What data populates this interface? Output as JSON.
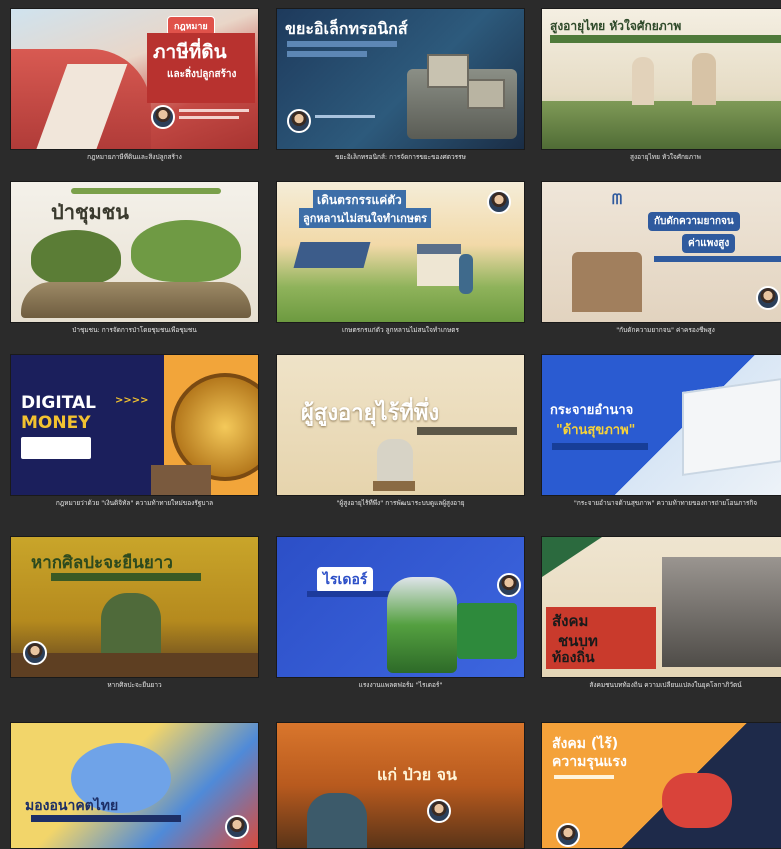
{
  "cards": [
    {
      "title": "ภาษีที่ดิน",
      "subtitle": "และสิ่งปลูกสร้าง",
      "badge": "กฎหมาย",
      "caption": "กฎหมายภาษีที่ดินและสิ่งปลูกสร้าง"
    },
    {
      "title": "ขยะอิเล็กทรอนิกส์",
      "caption": "ขยะอิเล็กทรอนิกส์: การจัดการขยะของศตวรรษ"
    },
    {
      "title": "สูงอายุไทย หัวใจศักยภาพ",
      "caption": "สูงอายุไทย หัวใจศักยภาพ"
    },
    {
      "title": "ป่าชุมชน",
      "caption": "ป่าชุมชน: การจัดการป่าโดยชุมชนเพื่อชุมชน"
    },
    {
      "title": "เดินตรกรรแค่ตัว",
      "subtitle": "ลูกหลานไม่สนใจทำเกษตร",
      "caption": "เกษตรกรแก่ตัว ลูกหลานไม่สนใจทำเกษตร"
    },
    {
      "title": "กับดักความยากจน",
      "subtitle": "ค่าแพงสูง",
      "caption": "\"กับดักความยากจน\" ค่าครองชีพสูง"
    },
    {
      "title": "DIGITAL",
      "subtitle": "MONEY",
      "arrows": ">>>>",
      "caption": "กฎหมายว่าด้วย \"เงินดิจิทัล\" ความท้าทายใหม่ของรัฐบาล"
    },
    {
      "title": "ผู้สูงอายุไร้ที่พึ่ง",
      "caption": "\"ผู้สูงอายุไร้ที่พึ่ง\" การพัฒนาระบบดูแลผู้สูงอายุ"
    },
    {
      "title": "กระจายอำนาจ",
      "subtitle": "\"ด้านสุขภาพ\"",
      "caption": "\"กระจายอำนาจด้านสุขภาพ\" ความท้าทายของการถ่ายโอนภารกิจ"
    },
    {
      "title": "หากศิลปะจะยืนยาว",
      "caption": "หากศิลปะจะยืนยาว"
    },
    {
      "title": "ไรเดอร์",
      "caption": "แรงงานแพลตฟอร์ม \"ไรเดอร์\""
    },
    {
      "title": "สังคม",
      "subtitle": "ชนบท",
      "extra": "ท้องถิ่น",
      "caption": "สังคมชนบทท้องถิ่น ความเปลี่ยนแปลงในยุคโลกาภิวัตน์"
    },
    {
      "title": "มองอนาคตไทย",
      "caption": ""
    },
    {
      "title": "แก่ ป่วย จน",
      "caption": ""
    },
    {
      "title": "สังคม (ไร้)",
      "subtitle": "ความรุนแรง",
      "caption": ""
    }
  ]
}
